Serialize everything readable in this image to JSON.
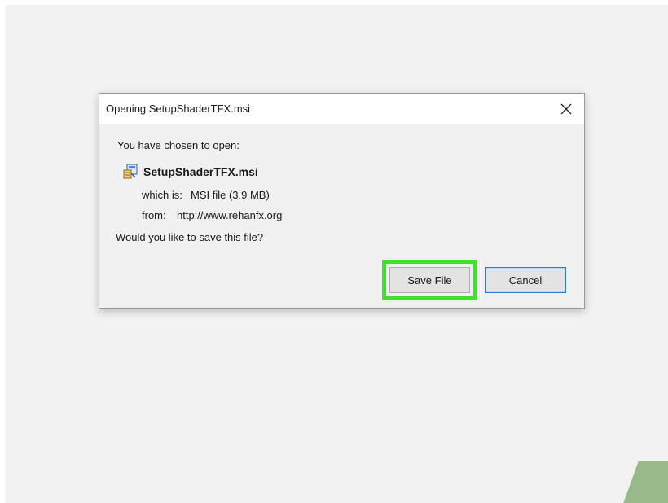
{
  "dialog": {
    "title": "Opening SetupShaderTFX.msi",
    "close_icon": "close-icon",
    "prompt": "You have chosen to open:",
    "file": {
      "icon": "msi-installer-icon",
      "name": "SetupShaderTFX.msi"
    },
    "which_label": "which is:",
    "which_value": "MSI file (3.9 MB)",
    "from_label": "from:",
    "from_value": "http://www.rehanfx.org",
    "question": "Would you like to save this file?",
    "buttons": {
      "save_label": "Save File",
      "cancel_label": "Cancel"
    }
  },
  "colors": {
    "highlight": "#3ee12a",
    "cancel_focus_border": "#2b7bd6",
    "corner_accent": "#9ab98a"
  }
}
